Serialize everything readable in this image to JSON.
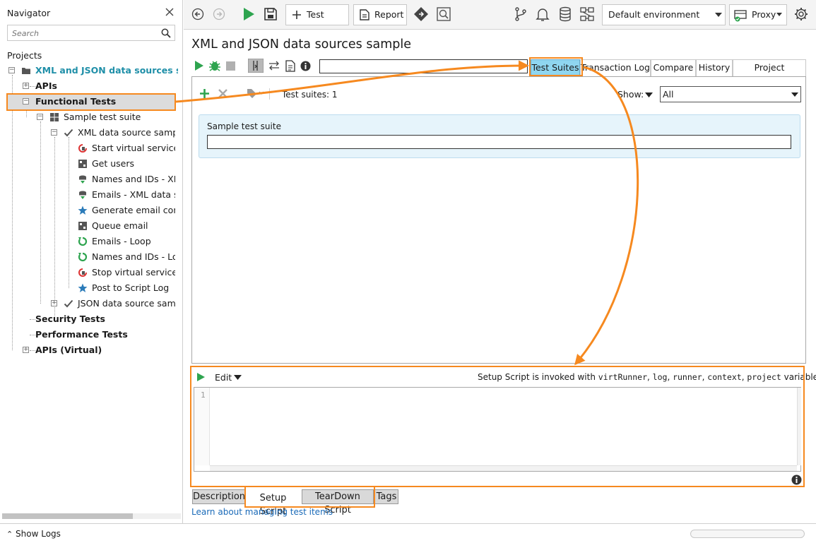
{
  "navigator": {
    "title": "Navigator",
    "search_placeholder": "Search",
    "projects_label": "Projects",
    "tree": {
      "project": "XML and JSON data sources sam",
      "apis": "APIs",
      "functional_tests": "Functional Tests",
      "suite": "Sample test suite",
      "xml_case": "XML data source sampl",
      "steps": [
        "Start virtual service",
        "Get users",
        "Names and IDs - XM",
        "Emails - XML data s",
        "Generate email cont",
        "Queue email",
        "Emails - Loop",
        "Names and IDs - Lo",
        "Stop virtual service",
        "Post to Script Log"
      ],
      "json_case": "JSON data source samp",
      "security_tests": "Security Tests",
      "performance_tests": "Performance Tests",
      "apis_virtual": "APIs (Virtual)"
    }
  },
  "toolbar": {
    "test_suite_label": "Test Suite",
    "report_label": "Report",
    "environment": "Default environment",
    "proxy_label": "Proxy"
  },
  "editor": {
    "title": "XML and JSON data sources sample",
    "tabs": [
      "Test Suites",
      "Transaction Log",
      "Compare",
      "History",
      "Project Coverage"
    ],
    "test_suites_count": "Test suites: 1",
    "show_label": "Show:",
    "show_value": "All",
    "suite_card_title": "Sample test suite",
    "script": {
      "edit_label": "Edit",
      "info_prefix": "Setup Script is invoked with ",
      "vars": [
        "virtRunner",
        "log",
        "runner",
        "context",
        "project"
      ],
      "info_suffix": " variables",
      "line_number": "1"
    },
    "bottom_tabs": [
      "Description",
      "Setup Script",
      "TearDown Script",
      "Tags"
    ],
    "learn_link": "Learn about managing test items"
  },
  "status": {
    "show_logs": "Show Logs"
  },
  "colors": {
    "accent_orange": "#f6891f",
    "selected_tab": "#8fd6f0",
    "teal": "#1f8fa8",
    "green": "#2ea44f"
  }
}
